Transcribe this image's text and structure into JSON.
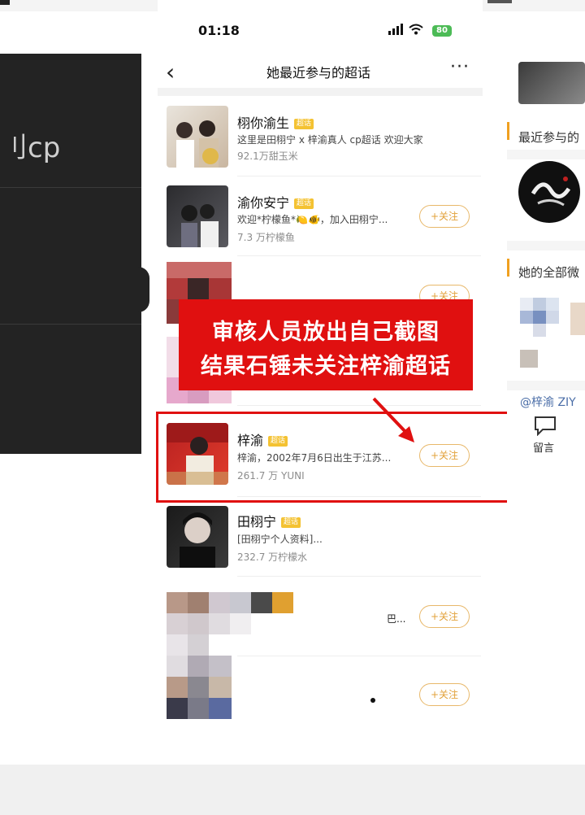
{
  "status": {
    "time": "01:18",
    "battery": "80"
  },
  "nav": {
    "title": "她最近参与的超话",
    "back_icon": "‹",
    "more_icon": "···"
  },
  "left_panel": {
    "text": "刂cp"
  },
  "items": [
    {
      "title": "栩你渝生",
      "tag": "超话",
      "desc": "这里是田栩宁 x 梓渝真人 cp超话 欢迎大家",
      "count": "92.1万甜玉米",
      "follow": ""
    },
    {
      "title": "渝你安宁",
      "tag": "超话",
      "desc": "欢迎*柠檬鱼*🍋🐠，加入田栩宁...",
      "count": "7.3 万柠檬鱼",
      "follow": "+关注"
    },
    {
      "title": "",
      "tag": "",
      "desc": "",
      "count": "",
      "follow": "+关注"
    },
    {
      "title": "梓渝",
      "tag": "超话",
      "desc": "梓渝，2002年7月6日出生于江苏...",
      "count": "261.7 万 YUNI",
      "follow": "+关注"
    },
    {
      "title": "田栩宁",
      "tag": "超话",
      "desc": "[田栩宁个人资料]...",
      "count": "232.7 万柠檬水",
      "follow": ""
    },
    {
      "title": "",
      "tag": "",
      "desc": "巴...",
      "count": "",
      "follow": "+关注"
    },
    {
      "title": "",
      "tag": "",
      "desc": "",
      "count": "",
      "follow": "+关注"
    }
  ],
  "banner": {
    "line1": "审核人员放出自己截图",
    "line2": "结果石锤未关注梓渝超话"
  },
  "right_panel": {
    "recent_label": "最近参与的",
    "all_label": "她的全部微",
    "mention": "@梓渝 ZIY",
    "comment_label": "留言"
  }
}
